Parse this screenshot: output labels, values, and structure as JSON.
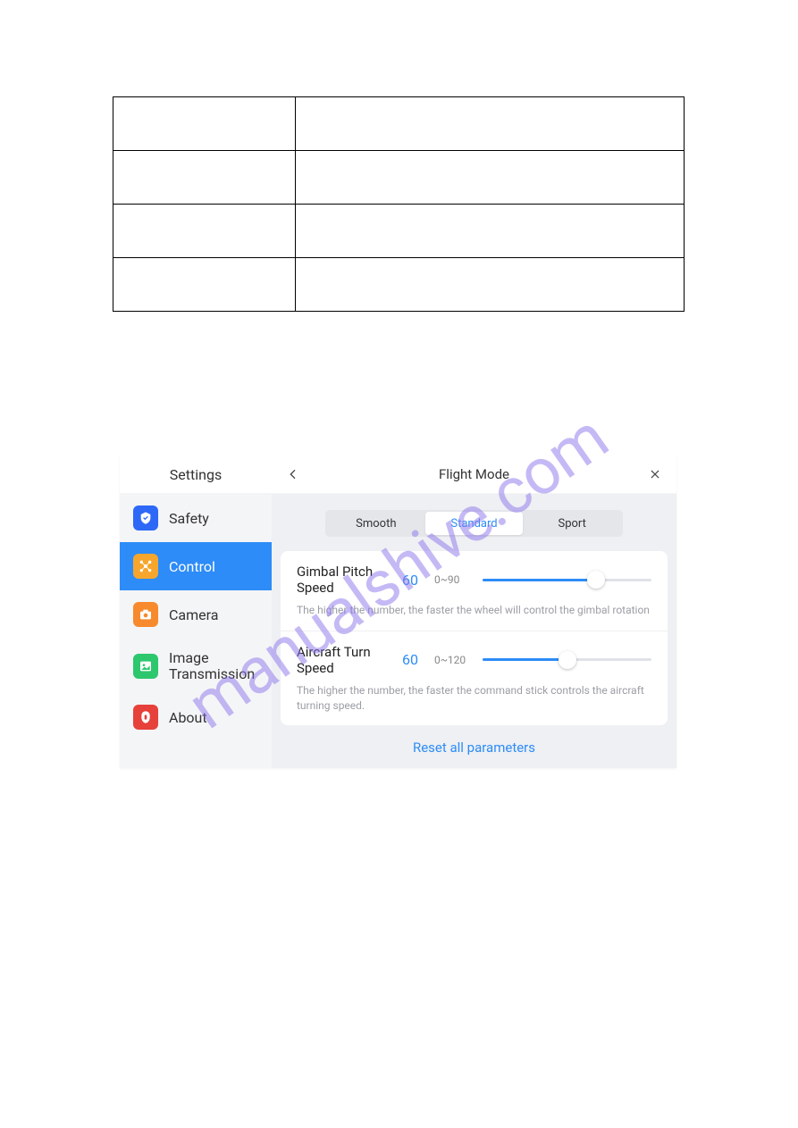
{
  "watermark": "manualshive.com",
  "sidebar": {
    "title": "Settings",
    "items": [
      {
        "label": "Safety"
      },
      {
        "label": "Control"
      },
      {
        "label": "Camera"
      },
      {
        "label": "Image Transmission"
      },
      {
        "label": "About"
      }
    ]
  },
  "content": {
    "title": "Flight Mode",
    "tabs": [
      {
        "label": "Smooth"
      },
      {
        "label": "Standard"
      },
      {
        "label": "Sport"
      }
    ],
    "rows": [
      {
        "label": "Gimbal Pitch Speed",
        "value": "60",
        "range": "0~90",
        "percent": 67,
        "desc": "The higher the number, the faster the wheel will control the gimbal rotation"
      },
      {
        "label": "Aircraft Turn Speed",
        "value": "60",
        "range": "0~120",
        "percent": 50,
        "desc": "The higher the number, the faster the command stick controls the aircraft turning speed."
      }
    ],
    "reset": "Reset all parameters"
  }
}
